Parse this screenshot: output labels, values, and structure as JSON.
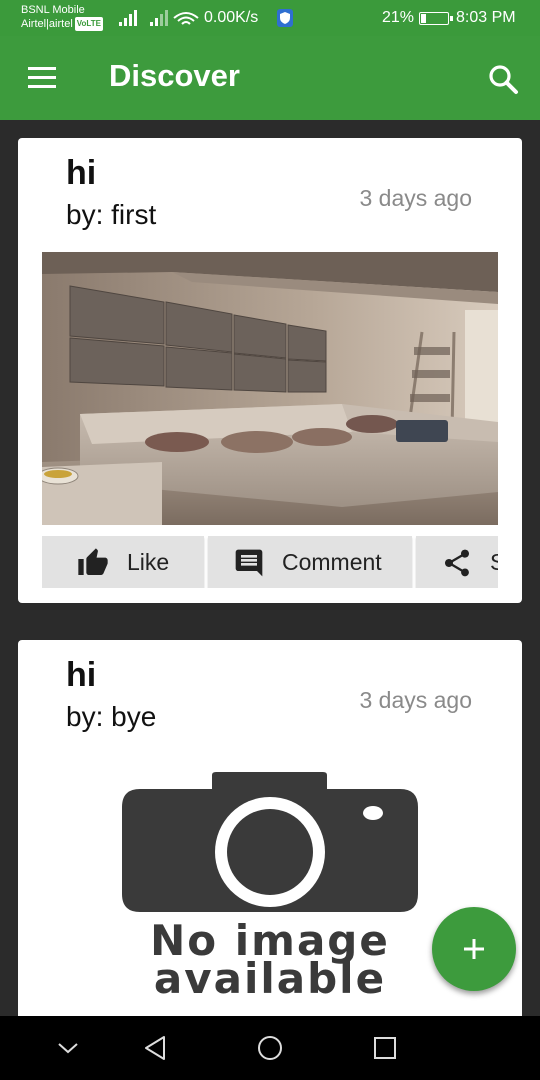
{
  "status_bar": {
    "carrier_1": "BSNL Mobile",
    "carrier_2": "Airtel|airtel",
    "volte": "VoLTE",
    "net_speed": "0.00K/s",
    "battery_percent": "21%",
    "battery_level": 0.21,
    "time": "8:03 PM"
  },
  "app_bar": {
    "title": "Discover",
    "menu_icon": "menu-icon",
    "search_icon": "search-icon",
    "color": "#3d9b3d"
  },
  "posts": [
    {
      "title": "hi",
      "author": "by: first",
      "time": "3 days ago",
      "image": "living-room-photo",
      "actions": {
        "like": "Like",
        "comment": "Comment",
        "share": "S"
      }
    },
    {
      "title": "hi",
      "author": "by: bye",
      "time": "3 days ago",
      "image_placeholder": {
        "line1": "No image",
        "line2": "available"
      }
    }
  ],
  "fab": {
    "icon": "plus-icon"
  },
  "nav_bar": {
    "icons": [
      "chevron-down-icon",
      "back-icon",
      "home-icon",
      "recents-icon"
    ]
  }
}
